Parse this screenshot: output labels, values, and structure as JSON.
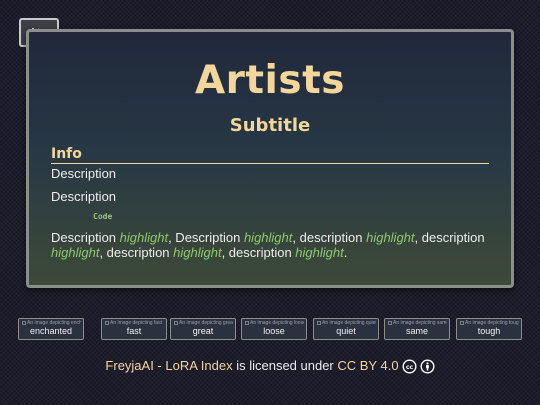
{
  "nav": {
    "back_icon": "arrow-bar-left-icon"
  },
  "card": {
    "title": "Artists",
    "subtitle": "Subtitle",
    "info_heading": "Info",
    "description_1": "Description",
    "description_2": "Description",
    "code": "Code",
    "paragraph": [
      {
        "text": "Description ",
        "highlight": false
      },
      {
        "text": "highlight",
        "highlight": true
      },
      {
        "text": ", Description ",
        "highlight": false
      },
      {
        "text": "highlight",
        "highlight": true
      },
      {
        "text": ", description ",
        "highlight": false
      },
      {
        "text": "highlight",
        "highlight": true
      },
      {
        "text": ", description ",
        "highlight": false
      },
      {
        "text": "highlight",
        "highlight": true
      },
      {
        "text": ", description ",
        "highlight": false
      },
      {
        "text": "highlight",
        "highlight": true
      },
      {
        "text": ", description ",
        "highlight": false
      },
      {
        "text": "highlight",
        "highlight": true
      },
      {
        "text": ".",
        "highlight": false
      }
    ]
  },
  "thumbnails": [
    {
      "alt": "An image depicting enchanted",
      "label": "enchanted"
    },
    {
      "alt": "An image depicting fast",
      "label": "fast"
    },
    {
      "alt": "An image depicting great",
      "label": "great"
    },
    {
      "alt": "An image depicting loose",
      "label": "loose"
    },
    {
      "alt": "An image depicting quiet",
      "label": "quiet"
    },
    {
      "alt": "An image depicting same",
      "label": "same"
    },
    {
      "alt": "An image depicting tough",
      "label": "tough"
    }
  ],
  "footer": {
    "project_link": "FreyjaAI - LoRA Index",
    "middle_text": " is licensed under ",
    "license_link": "CC BY 4.0",
    "icons": [
      "creative-commons-icon",
      "attribution-icon"
    ]
  },
  "colors": {
    "accent": "#f3d79a",
    "highlight": "#8ec86a",
    "code": "#9fbf84",
    "text": "#ededed",
    "background": "#1c1c2c"
  }
}
